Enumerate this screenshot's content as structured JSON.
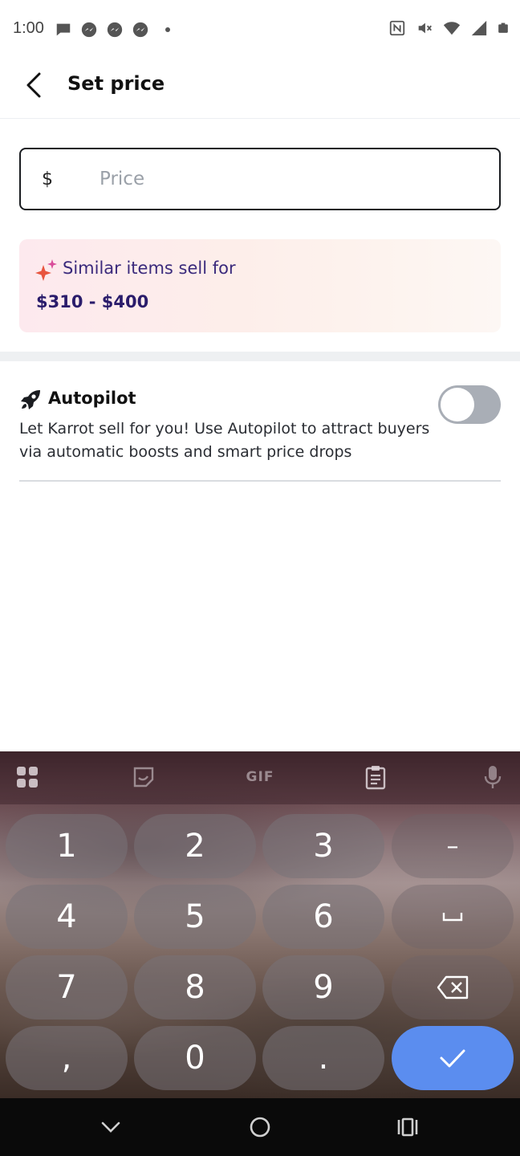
{
  "status_bar": {
    "time": "1:00",
    "left_icons": [
      "chat-bubble-icon",
      "messenger-icon",
      "messenger-icon",
      "messenger-icon",
      "dot-icon"
    ],
    "right_icons": [
      "nfc-icon",
      "vibrate-off-icon",
      "wifi-icon",
      "signal-icon",
      "battery-icon"
    ]
  },
  "app_bar": {
    "title": "Set price",
    "back_icon": "arrow-back-icon"
  },
  "price_field": {
    "currency_symbol": "$",
    "placeholder": "Price",
    "value": ""
  },
  "suggestion": {
    "label": "Similar items sell for",
    "range": "$310 - $400",
    "icon": "sparkle-icon"
  },
  "autopilot": {
    "title": "Autopilot",
    "description": "Let Karrot sell for you! Use Autopilot to attract buyers via automatic boosts and smart price drops",
    "enabled": false,
    "icon": "rocket-icon"
  },
  "keyboard": {
    "toolbar": {
      "apps_icon": "grid-icon",
      "sticker_icon": "sticker-icon",
      "gif_label": "GIF",
      "clipboard_icon": "clipboard-icon",
      "mic_icon": "mic-icon"
    },
    "keys": {
      "k1": "1",
      "k2": "2",
      "k3": "3",
      "dash": "–",
      "k4": "4",
      "k5": "5",
      "k6": "6",
      "k7": "7",
      "k8": "8",
      "k9": "9",
      "comma": ",",
      "k0": "0",
      "period": "."
    },
    "done_color": "#5b8def"
  },
  "nav_bar": {
    "back_icon": "chevron-down-icon",
    "home_icon": "home-circle-icon",
    "recents_icon": "recents-icon"
  },
  "colors": {
    "accent_text": "#3b2a7c",
    "range_text": "#2a1c6b",
    "toggle_off": "#a9aeb6"
  }
}
